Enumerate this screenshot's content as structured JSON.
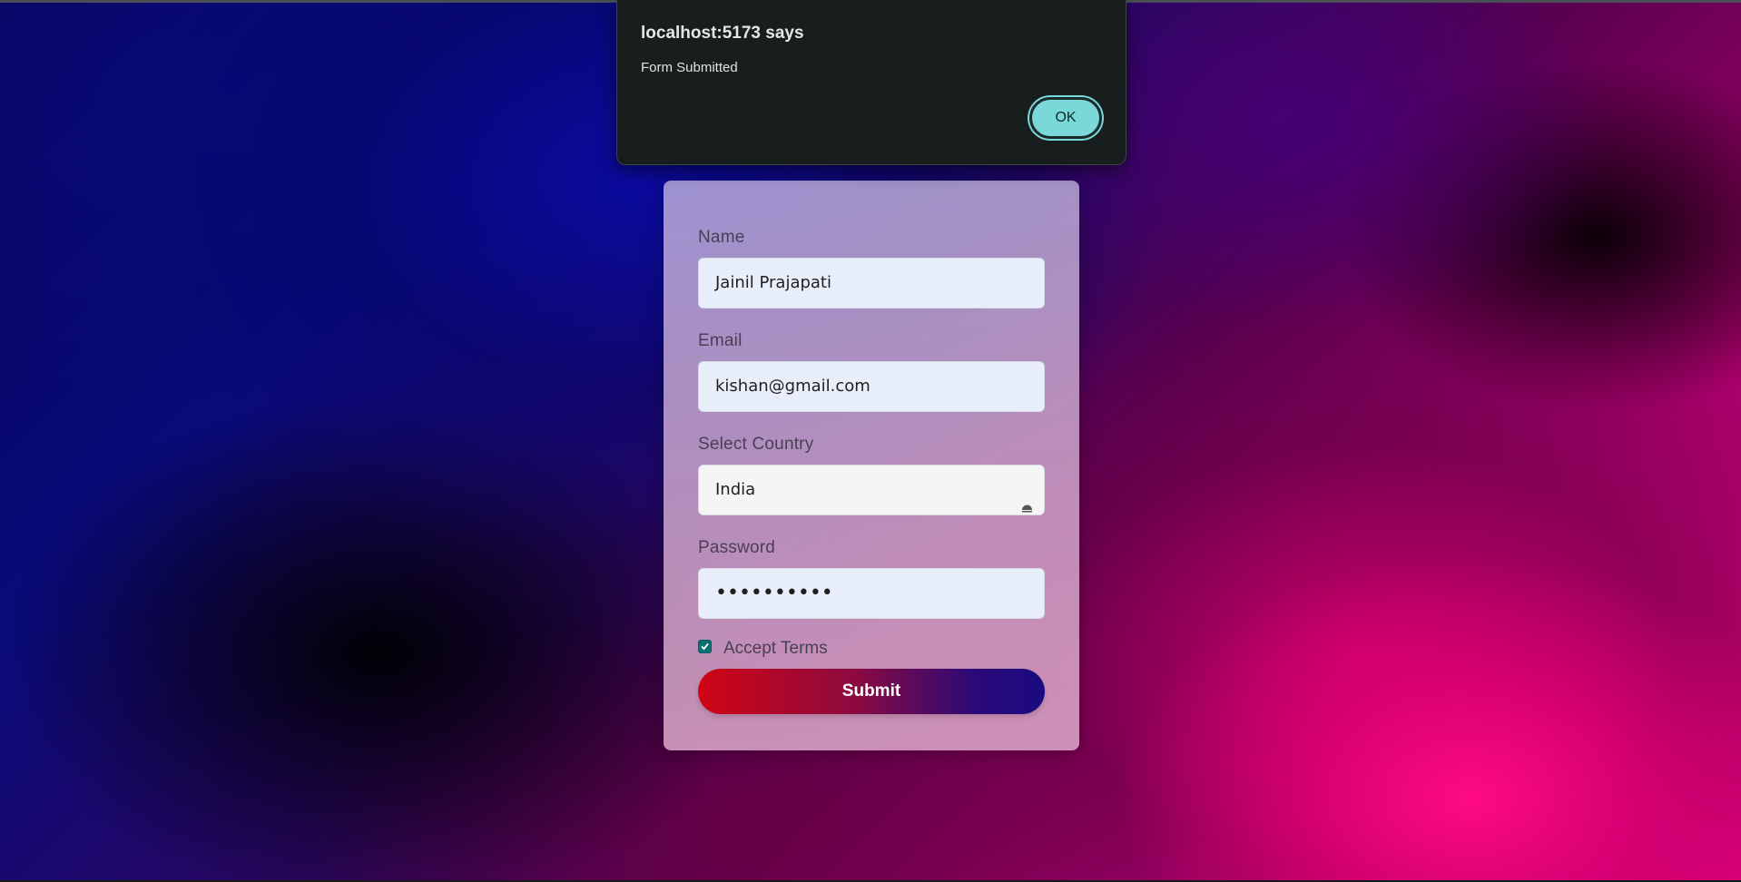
{
  "dialog": {
    "title": "localhost:5173 says",
    "message": "Form Submitted",
    "ok_label": "OK"
  },
  "form": {
    "name": {
      "label": "Name",
      "value": "Jainil Prajapati"
    },
    "email": {
      "label": "Email",
      "value": "kishan@gmail.com"
    },
    "country": {
      "label": "Select Country",
      "selected": "India"
    },
    "password": {
      "label": "Password",
      "masked_value": "••••••••••"
    },
    "terms": {
      "label": "Accept Terms",
      "checked": true
    },
    "submit_label": "Submit"
  },
  "colors": {
    "accent_teal": "#7ad8d8",
    "checkbox": "#0b6f73",
    "submit_gradient_start": "#d00514",
    "submit_gradient_end": "#1a0a80",
    "dialog_bg": "#181e1d"
  },
  "icons": {
    "select_arrow": "dropdown-arrow-icon",
    "checkbox_check": "checkmark-icon"
  }
}
